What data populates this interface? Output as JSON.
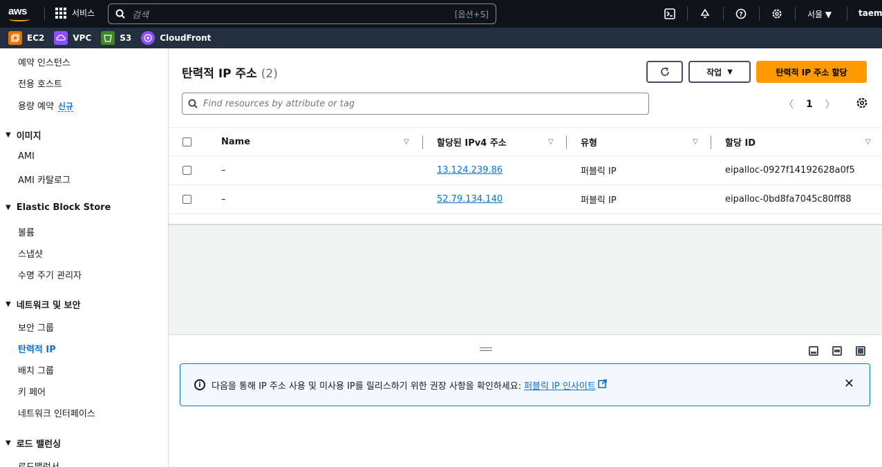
{
  "topbar": {
    "logo_text": "aws",
    "services_label": "서비스",
    "search_placeholder": "검색",
    "search_shortcut": "[옵션+S]",
    "region_label": "서울 ▼",
    "user_label": "taemi"
  },
  "favorites": [
    {
      "label": "EC2",
      "color": "#ed7100"
    },
    {
      "label": "VPC",
      "color": "#8c4fff"
    },
    {
      "label": "S3",
      "color": "#3f8624"
    },
    {
      "label": "CloudFront",
      "color": "#8c4fff"
    }
  ],
  "sidebar": {
    "items_top": [
      "예약 인스턴스",
      "전용 호스트",
      "용량 예약"
    ],
    "new_badge": "신규",
    "section_images": "이미지",
    "images_items": [
      "AMI",
      "AMI 카탈로그"
    ],
    "section_ebs": "Elastic Block Store",
    "ebs_items": [
      "볼륨",
      "스냅샷",
      "수명 주기 관리자"
    ],
    "section_network": "네트워크 및 보안",
    "network_items": [
      "보안 그룹",
      "탄력적 IP",
      "배치 그룹",
      "키 페어",
      "네트워크 인터페이스"
    ],
    "section_lb": "로드 밸런싱",
    "lb_partial": "로드밸런서"
  },
  "main": {
    "title": "탄력적 IP 주소",
    "count": "(2)",
    "actions_label": "작업",
    "allocate_label": "탄력적 IP 주소 할당",
    "filter_placeholder": "Find resources by attribute or tag",
    "page_number": "1"
  },
  "table": {
    "headers": [
      "Name",
      "할당된 IPv4 주소",
      "유형",
      "할당 ID"
    ],
    "rows": [
      {
        "name": "–",
        "ip": "13.124.239.86",
        "type": "퍼블릭 IP",
        "alloc_id": "eipalloc-0927f14192628a0f5"
      },
      {
        "name": "–",
        "ip": "52.79.134.140",
        "type": "퍼블릭 IP",
        "alloc_id": "eipalloc-0bd8fa7045c80ff88"
      }
    ]
  },
  "info_banner": {
    "text": "다음을 통해 IP 주소 사용 및 미사용 IP를 릴리스하기 위한 권장 사항을 확인하세요: ",
    "link": "퍼블릭 IP 인사이트"
  }
}
